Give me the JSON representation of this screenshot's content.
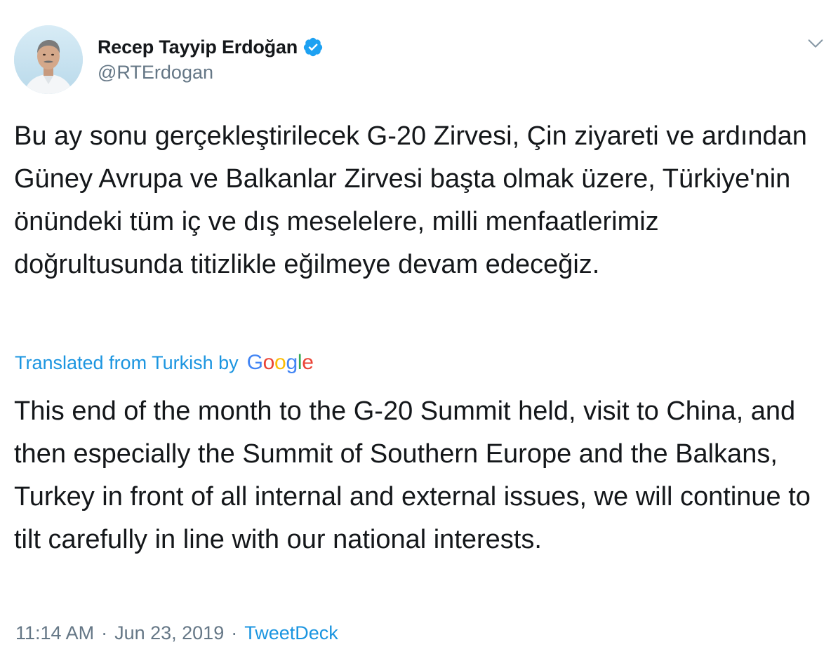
{
  "author": {
    "display_name": "Recep Tayyip Erdoğan",
    "handle": "@RTErdogan",
    "verified": true
  },
  "tweet": {
    "original_text": "Bu ay sonu gerçekleştirilecek G-20 Zirvesi, Çin ziyareti ve ardından Güney Avrupa ve Balkanlar Zirvesi başta olmak üzere, Türkiye'nin önündeki tüm iç ve dış meselelere, milli menfaatlerimiz doğrultusunda titizlikle eğilmeye devam edeceğiz.",
    "translation_label": "Translated from Turkish by",
    "translation_provider": {
      "letters": [
        "G",
        "o",
        "o",
        "g",
        "l",
        "e"
      ]
    },
    "translated_text": "This end of the month to the G-20 Summit held, visit to China, and then especially the Summit of Southern Europe and the Balkans, Turkey in front of all internal and external issues, we will continue to tilt carefully in line with our national interests."
  },
  "meta": {
    "time": "11:14 AM",
    "separator": "·",
    "date": "Jun 23, 2019",
    "source": "TweetDeck"
  },
  "icons": {
    "verified": "verified-badge-icon",
    "caret": "chevron-down-icon"
  },
  "colors": {
    "text_primary": "#14171a",
    "text_secondary": "#657786",
    "link_blue": "#1b95e0",
    "verified_blue": "#1da1f2"
  }
}
